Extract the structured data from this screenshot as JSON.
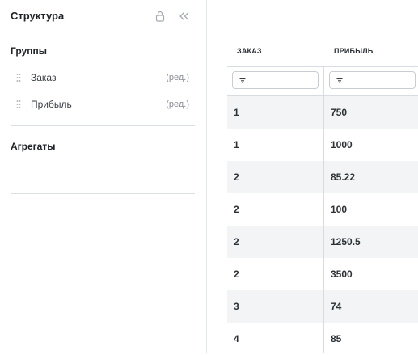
{
  "panel": {
    "title": "Структура",
    "groups_title": "Группы",
    "groups": [
      {
        "label": "Заказ",
        "edit": "(ред.)"
      },
      {
        "label": "Прибыль",
        "edit": "(ред.)"
      }
    ],
    "aggregates_title": "Агрегаты"
  },
  "table": {
    "columns": [
      "ЗАКАЗ",
      "ПРИБЫЛЬ"
    ],
    "rows": [
      [
        "1",
        "750"
      ],
      [
        "1",
        "1000"
      ],
      [
        "2",
        "85.22"
      ],
      [
        "2",
        "100"
      ],
      [
        "2",
        "1250.5"
      ],
      [
        "2",
        "3500"
      ],
      [
        "3",
        "74"
      ],
      [
        "4",
        "85"
      ]
    ]
  },
  "icons": {
    "lock": "lock-icon",
    "collapse": "double-chevron-left-icon",
    "grip": "drag-handle-icon",
    "filter": "filter-icon"
  },
  "colors": {
    "row_stripe": "#f3f4f6",
    "border": "#dcdfe3",
    "muted_text": "#8a8f96"
  }
}
